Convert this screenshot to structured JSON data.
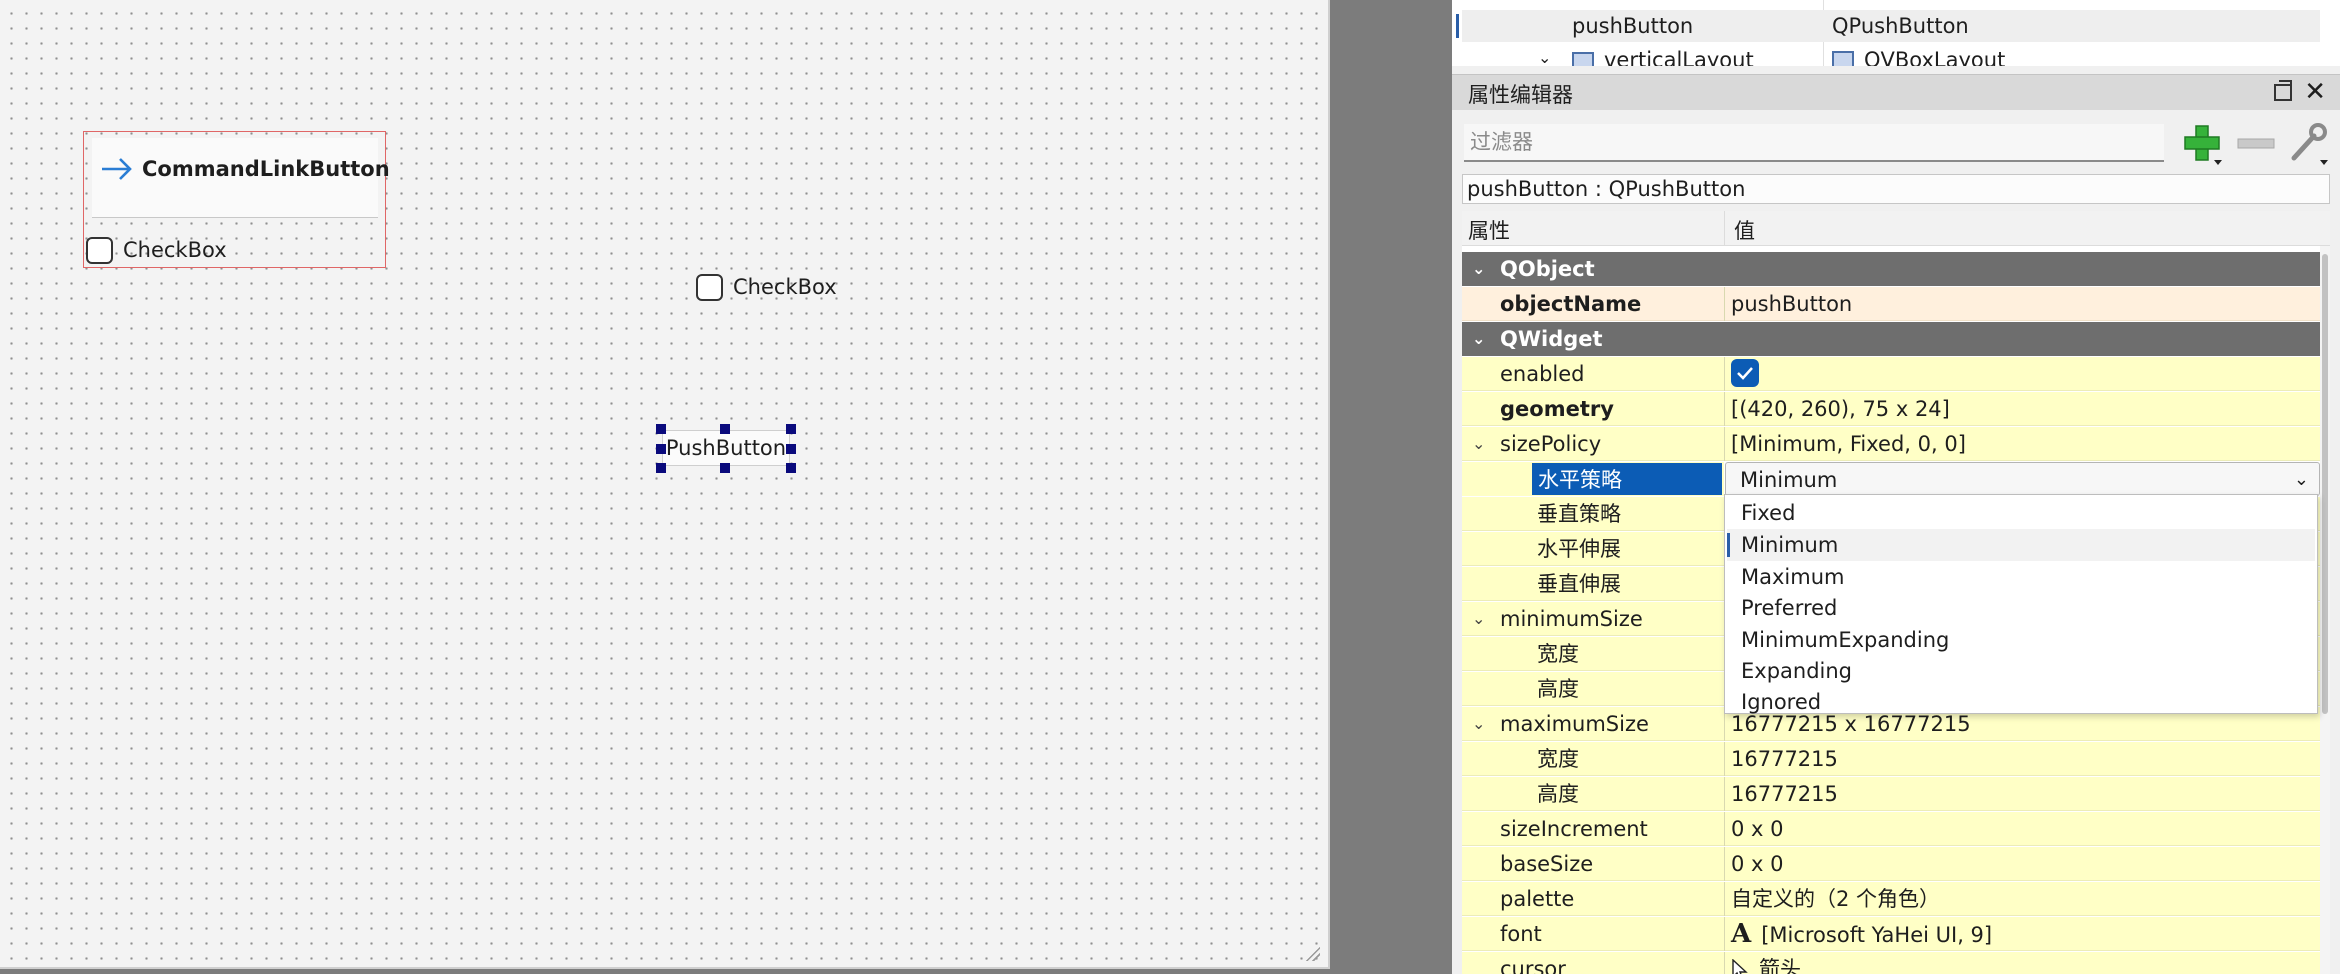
{
  "canvas": {
    "command_link_label": "CommandLinkButton",
    "checkbox1_label": "CheckBox",
    "checkbox2_label": "CheckBox",
    "push_button_label": "PushButton"
  },
  "object_inspector": {
    "rows": [
      {
        "name": "pushButton",
        "class": "QPushButton"
      },
      {
        "name": "verticalLayout",
        "class": "QVBoxLayout"
      }
    ]
  },
  "property_editor": {
    "title": "属性编辑器",
    "filter_placeholder": "过滤器",
    "object_class_line": "pushButton : QPushButton",
    "header_property": "属性",
    "header_value": "值",
    "groups": {
      "qobject": "QObject",
      "qwidget": "QWidget"
    },
    "props": {
      "objectName": {
        "name": "objectName",
        "value": "pushButton"
      },
      "enabled": {
        "name": "enabled",
        "value": true
      },
      "geometry": {
        "name": "geometry",
        "value": "[(420, 260), 75 x 24]"
      },
      "sizePolicy": {
        "name": "sizePolicy",
        "value": "[Minimum, Fixed, 0, 0]"
      },
      "hPolicy": {
        "name": "水平策略",
        "value": "Minimum"
      },
      "vPolicy": {
        "name": "垂直策略"
      },
      "hStretch": {
        "name": "水平伸展"
      },
      "vStretch": {
        "name": "垂直伸展"
      },
      "minimumSize": {
        "name": "minimumSize"
      },
      "minWidth": {
        "name": "宽度"
      },
      "minHeight": {
        "name": "高度"
      },
      "maximumSize": {
        "name": "maximumSize",
        "value": "16777215 x 16777215"
      },
      "maxWidth": {
        "name": "宽度",
        "value": "16777215"
      },
      "maxHeight": {
        "name": "高度",
        "value": "16777215"
      },
      "sizeIncrement": {
        "name": "sizeIncrement",
        "value": "0 x 0"
      },
      "baseSize": {
        "name": "baseSize",
        "value": "0 x 0"
      },
      "palette": {
        "name": "palette",
        "value": "自定义的（2 个角色）"
      },
      "font": {
        "name": "font",
        "value": "[Microsoft YaHei UI, 9]"
      },
      "cursor": {
        "name": "cursor",
        "value": "箭头"
      }
    },
    "dropdown": {
      "options": [
        "Fixed",
        "Minimum",
        "Maximum",
        "Preferred",
        "MinimumExpanding",
        "Expanding",
        "Ignored"
      ],
      "selected": "Minimum"
    }
  },
  "colors": {
    "group_header": "#6e6e6e",
    "row_yellow": "#ffffc6",
    "row_orange": "#fff0dd",
    "selection_blue": "#0c5cb5",
    "handle_navy": "#0a0a7c"
  },
  "icons": [
    "arrow-right-icon",
    "float-icon",
    "close-icon",
    "add-icon",
    "remove-icon",
    "wrench-icon",
    "checkmark-icon",
    "font-icon",
    "arrow-cursor-icon",
    "chevron-down-icon",
    "chevron-right-icon",
    "layout-icon"
  ]
}
